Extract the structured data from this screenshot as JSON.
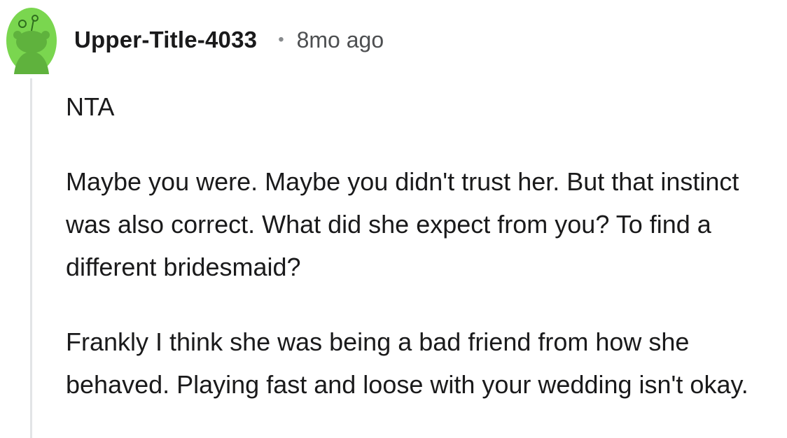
{
  "comment": {
    "username": "Upper-Title-4033",
    "separator": "•",
    "timestamp": "8mo ago",
    "avatar_icon": "snoo-avatar-icon",
    "avatar_color": "#7ad64f",
    "paragraphs": [
      "NTA",
      "Maybe you were. Maybe you didn't trust her. But that instinct was also correct. What did she expect from you? To find a different bridesmaid?",
      "Frankly I think she was being a bad friend from how she behaved. Playing fast and loose with your wedding isn't okay."
    ]
  }
}
